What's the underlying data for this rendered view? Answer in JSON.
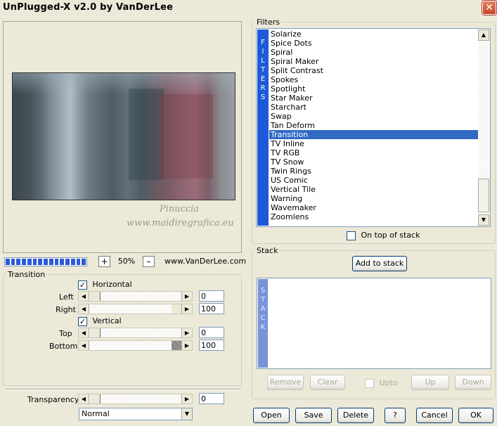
{
  "window": {
    "title": "UnPlugged-X v2.0 by VanDerLee",
    "close_label": "✕"
  },
  "preview": {
    "watermark_line1": "Pinuccia",
    "watermark_line2": "www.maidiregrafica.eu"
  },
  "zoom": {
    "minus": "–",
    "plus": "+",
    "value": "50%",
    "progress_fraction": 1.0
  },
  "site_link": "www.VanDerLee.com",
  "transition_group": {
    "legend": "Transition",
    "horizontal_label": "Horizontal",
    "horizontal_checked": "✓",
    "vertical_label": "Vertical",
    "vertical_checked": "✓",
    "left_label": "Left",
    "left_value": "0",
    "right_label": "Right",
    "right_value": "100",
    "top_label": "Top",
    "top_value": "0",
    "bottom_label": "Bottom",
    "bottom_value": "100"
  },
  "transparency": {
    "label": "Transparency",
    "value": "0"
  },
  "blend_mode": {
    "selected": "Normal"
  },
  "filters": {
    "legend": "Filters",
    "side_label": [
      "F",
      "I",
      "L",
      "T",
      "E",
      "R",
      "S"
    ],
    "items": [
      "Solarize",
      "Spice Dots",
      "Spiral",
      "Spiral Maker",
      "Split Contrast",
      "Spokes",
      "Spotlight",
      "Star Maker",
      "Starchart",
      "Swap",
      "Tan Deform",
      "Transition",
      "TV Inline",
      "TV RGB",
      "TV Snow",
      "Twin Rings",
      "US Comic",
      "Vertical Tile",
      "Warning",
      "Wavemaker",
      "Zoomlens"
    ],
    "selected": "Transition",
    "on_top_label": "On top of stack"
  },
  "stack": {
    "legend": "Stack",
    "add_button": "Add to stack",
    "side_label": [
      "S",
      "T",
      "A",
      "C",
      "K"
    ],
    "remove": "Remove",
    "clear": "Clear",
    "upto": "Upto",
    "up": "Up",
    "down": "Down"
  },
  "footer": {
    "open": "Open",
    "save": "Save",
    "delete": "Delete",
    "help": "?",
    "cancel": "Cancel",
    "ok": "OK"
  }
}
